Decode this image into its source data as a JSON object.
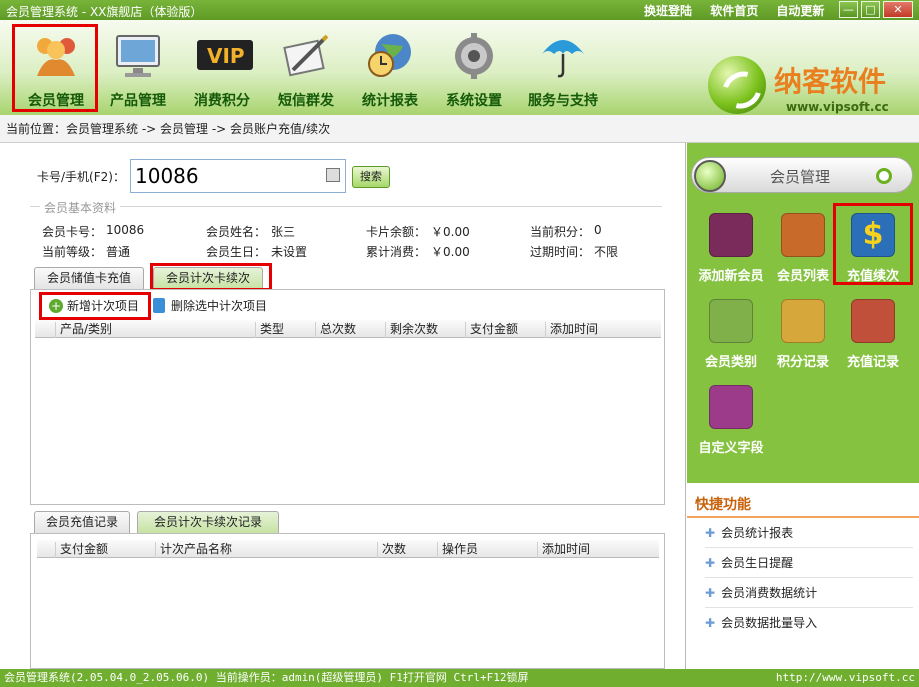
{
  "window": {
    "title": "会员管理系统 - XX旗舰店（体验版）",
    "links": [
      "换班登陆",
      "软件首页",
      "自动更新"
    ]
  },
  "toolbar": [
    {
      "label": "会员管理",
      "icon": "people-icon"
    },
    {
      "label": "产品管理",
      "icon": "monitor-icon"
    },
    {
      "label": "消费积分",
      "icon": "vip-icon"
    },
    {
      "label": "短信群发",
      "icon": "sms-icon"
    },
    {
      "label": "统计报表",
      "icon": "globe-clock-icon"
    },
    {
      "label": "系统设置",
      "icon": "gear-icon"
    },
    {
      "label": "服务与支持",
      "icon": "umbrella-icon"
    }
  ],
  "brand": {
    "name": "纳客软件",
    "url": "www.vipsoft.cc"
  },
  "breadcrumb": "当前位置：会员管理系统 -> 会员管理 -> 会员账户充值/续次",
  "search": {
    "label": "卡号/手机(F2)：",
    "value": "10086",
    "button": "搜索"
  },
  "member": {
    "section": "会员基本资料",
    "fields": [
      {
        "label": "会员卡号：",
        "value": "10086"
      },
      {
        "label": "会员姓名：",
        "value": "张三"
      },
      {
        "label": "卡片余额：",
        "value": "￥0.00"
      },
      {
        "label": "当前积分：",
        "value": "0"
      },
      {
        "label": "当前等级：",
        "value": "普通"
      },
      {
        "label": "会员生日：",
        "value": "未设置"
      },
      {
        "label": "累计消费：",
        "value": "￥0.00"
      },
      {
        "label": "过期时间：",
        "value": "不限"
      }
    ]
  },
  "tabs_top": [
    "会员储值卡充值",
    "会员计次卡续次"
  ],
  "actions": {
    "add": "新增计次项目",
    "delete": "删除选中计次项目"
  },
  "grid1_cols": [
    "产品/类别",
    "类型",
    "总次数",
    "剩余次数",
    "支付金额",
    "添加时间"
  ],
  "tabs_bottom": [
    "会员充值记录",
    "会员计次卡续次记录"
  ],
  "grid2_cols": [
    "支付金额",
    "计次产品名称",
    "次数",
    "操作员",
    "添加时间"
  ],
  "panel_title": "会员管理",
  "functions": [
    {
      "label": "添加新会员",
      "icon": "add-member-icon",
      "color": "#7a2b5c"
    },
    {
      "label": "会员列表",
      "icon": "member-list-icon",
      "color": "#c86a2a"
    },
    {
      "label": "充值续次",
      "icon": "dollar-icon",
      "color": "#2a6fb8"
    },
    {
      "label": "会员类别",
      "icon": "category-icon",
      "color": "#7fb04a"
    },
    {
      "label": "积分记录",
      "icon": "points-truck-icon",
      "color": "#d6a73a"
    },
    {
      "label": "充值记录",
      "icon": "recharge-record-icon",
      "color": "#c0503a"
    },
    {
      "label": "自定义字段",
      "icon": "pins-icon",
      "color": "#9b3b8a"
    }
  ],
  "quick": {
    "title": "快捷功能",
    "items": [
      "会员统计报表",
      "会员生日提醒",
      "会员消费数据统计",
      "会员数据批量导入"
    ]
  },
  "status": {
    "text": "会员管理系统(2.05.04.0_2.05.06.0) 当前操作员：admin(超级管理员) F1打开官网 Ctrl+F12锁屏",
    "url": "http://www.vipsoft.cc"
  }
}
